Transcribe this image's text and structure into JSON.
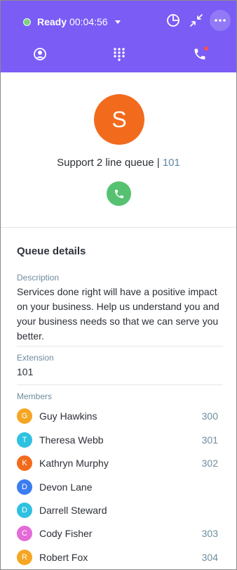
{
  "header": {
    "status_label": "Ready",
    "timer": "00:04:56",
    "status_color": "#7fd07f",
    "background": "#7b5cf5"
  },
  "tabs": [
    {
      "icon": "contact-icon"
    },
    {
      "icon": "dialpad-icon"
    },
    {
      "icon": "phone-calls-icon",
      "has_notification": true
    }
  ],
  "queue": {
    "avatar_letter": "S",
    "avatar_color": "#f26b1d",
    "name": "Support 2 line queue",
    "separator": " | ",
    "extension": "101"
  },
  "details": {
    "title": "Queue details",
    "description_label": "Description",
    "description": "Services done right will have a positive impact on your business. Help us understand you and your business needs so that we can serve you better.",
    "extension_label": "Extension",
    "extension": "101",
    "members_label": "Members"
  },
  "members": [
    {
      "initial": "G",
      "name": "Guy Hawkins",
      "ext": "300",
      "color": "#f5a623"
    },
    {
      "initial": "T",
      "name": "Theresa Webb",
      "ext": "301",
      "color": "#2ec2e0"
    },
    {
      "initial": "K",
      "name": "Kathryn Murphy",
      "ext": "302",
      "color": "#f26b1d"
    },
    {
      "initial": "D",
      "name": "Devon Lane",
      "ext": "",
      "color": "#3b7cf0"
    },
    {
      "initial": "D",
      "name": "Darrell Steward",
      "ext": "",
      "color": "#2ec2e0"
    },
    {
      "initial": "C",
      "name": "Cody Fisher",
      "ext": "303",
      "color": "#e46ad6"
    },
    {
      "initial": "R",
      "name": "Robert Fox",
      "ext": "304",
      "color": "#f5a623"
    }
  ]
}
